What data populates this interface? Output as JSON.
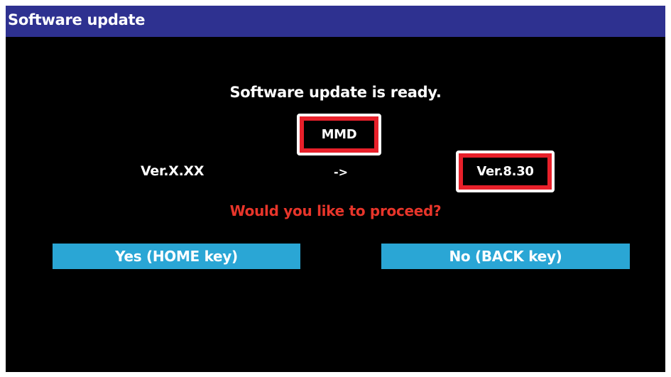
{
  "window": {
    "title": "Software update"
  },
  "dialog": {
    "ready_message": "Software update is ready.",
    "module_name": "MMD",
    "current_version": "Ver.X.XX",
    "arrow": "->",
    "target_version": "Ver.8.30",
    "prompt": "Would you like to proceed?"
  },
  "buttons": {
    "yes_label": "Yes (HOME key)",
    "no_label": "No (BACK key)"
  },
  "colors": {
    "title_bar": "#2e3190",
    "background": "#000000",
    "prompt_text": "#e8352a",
    "highlight_frame": "#e8202a",
    "button": "#2aa6d5"
  }
}
